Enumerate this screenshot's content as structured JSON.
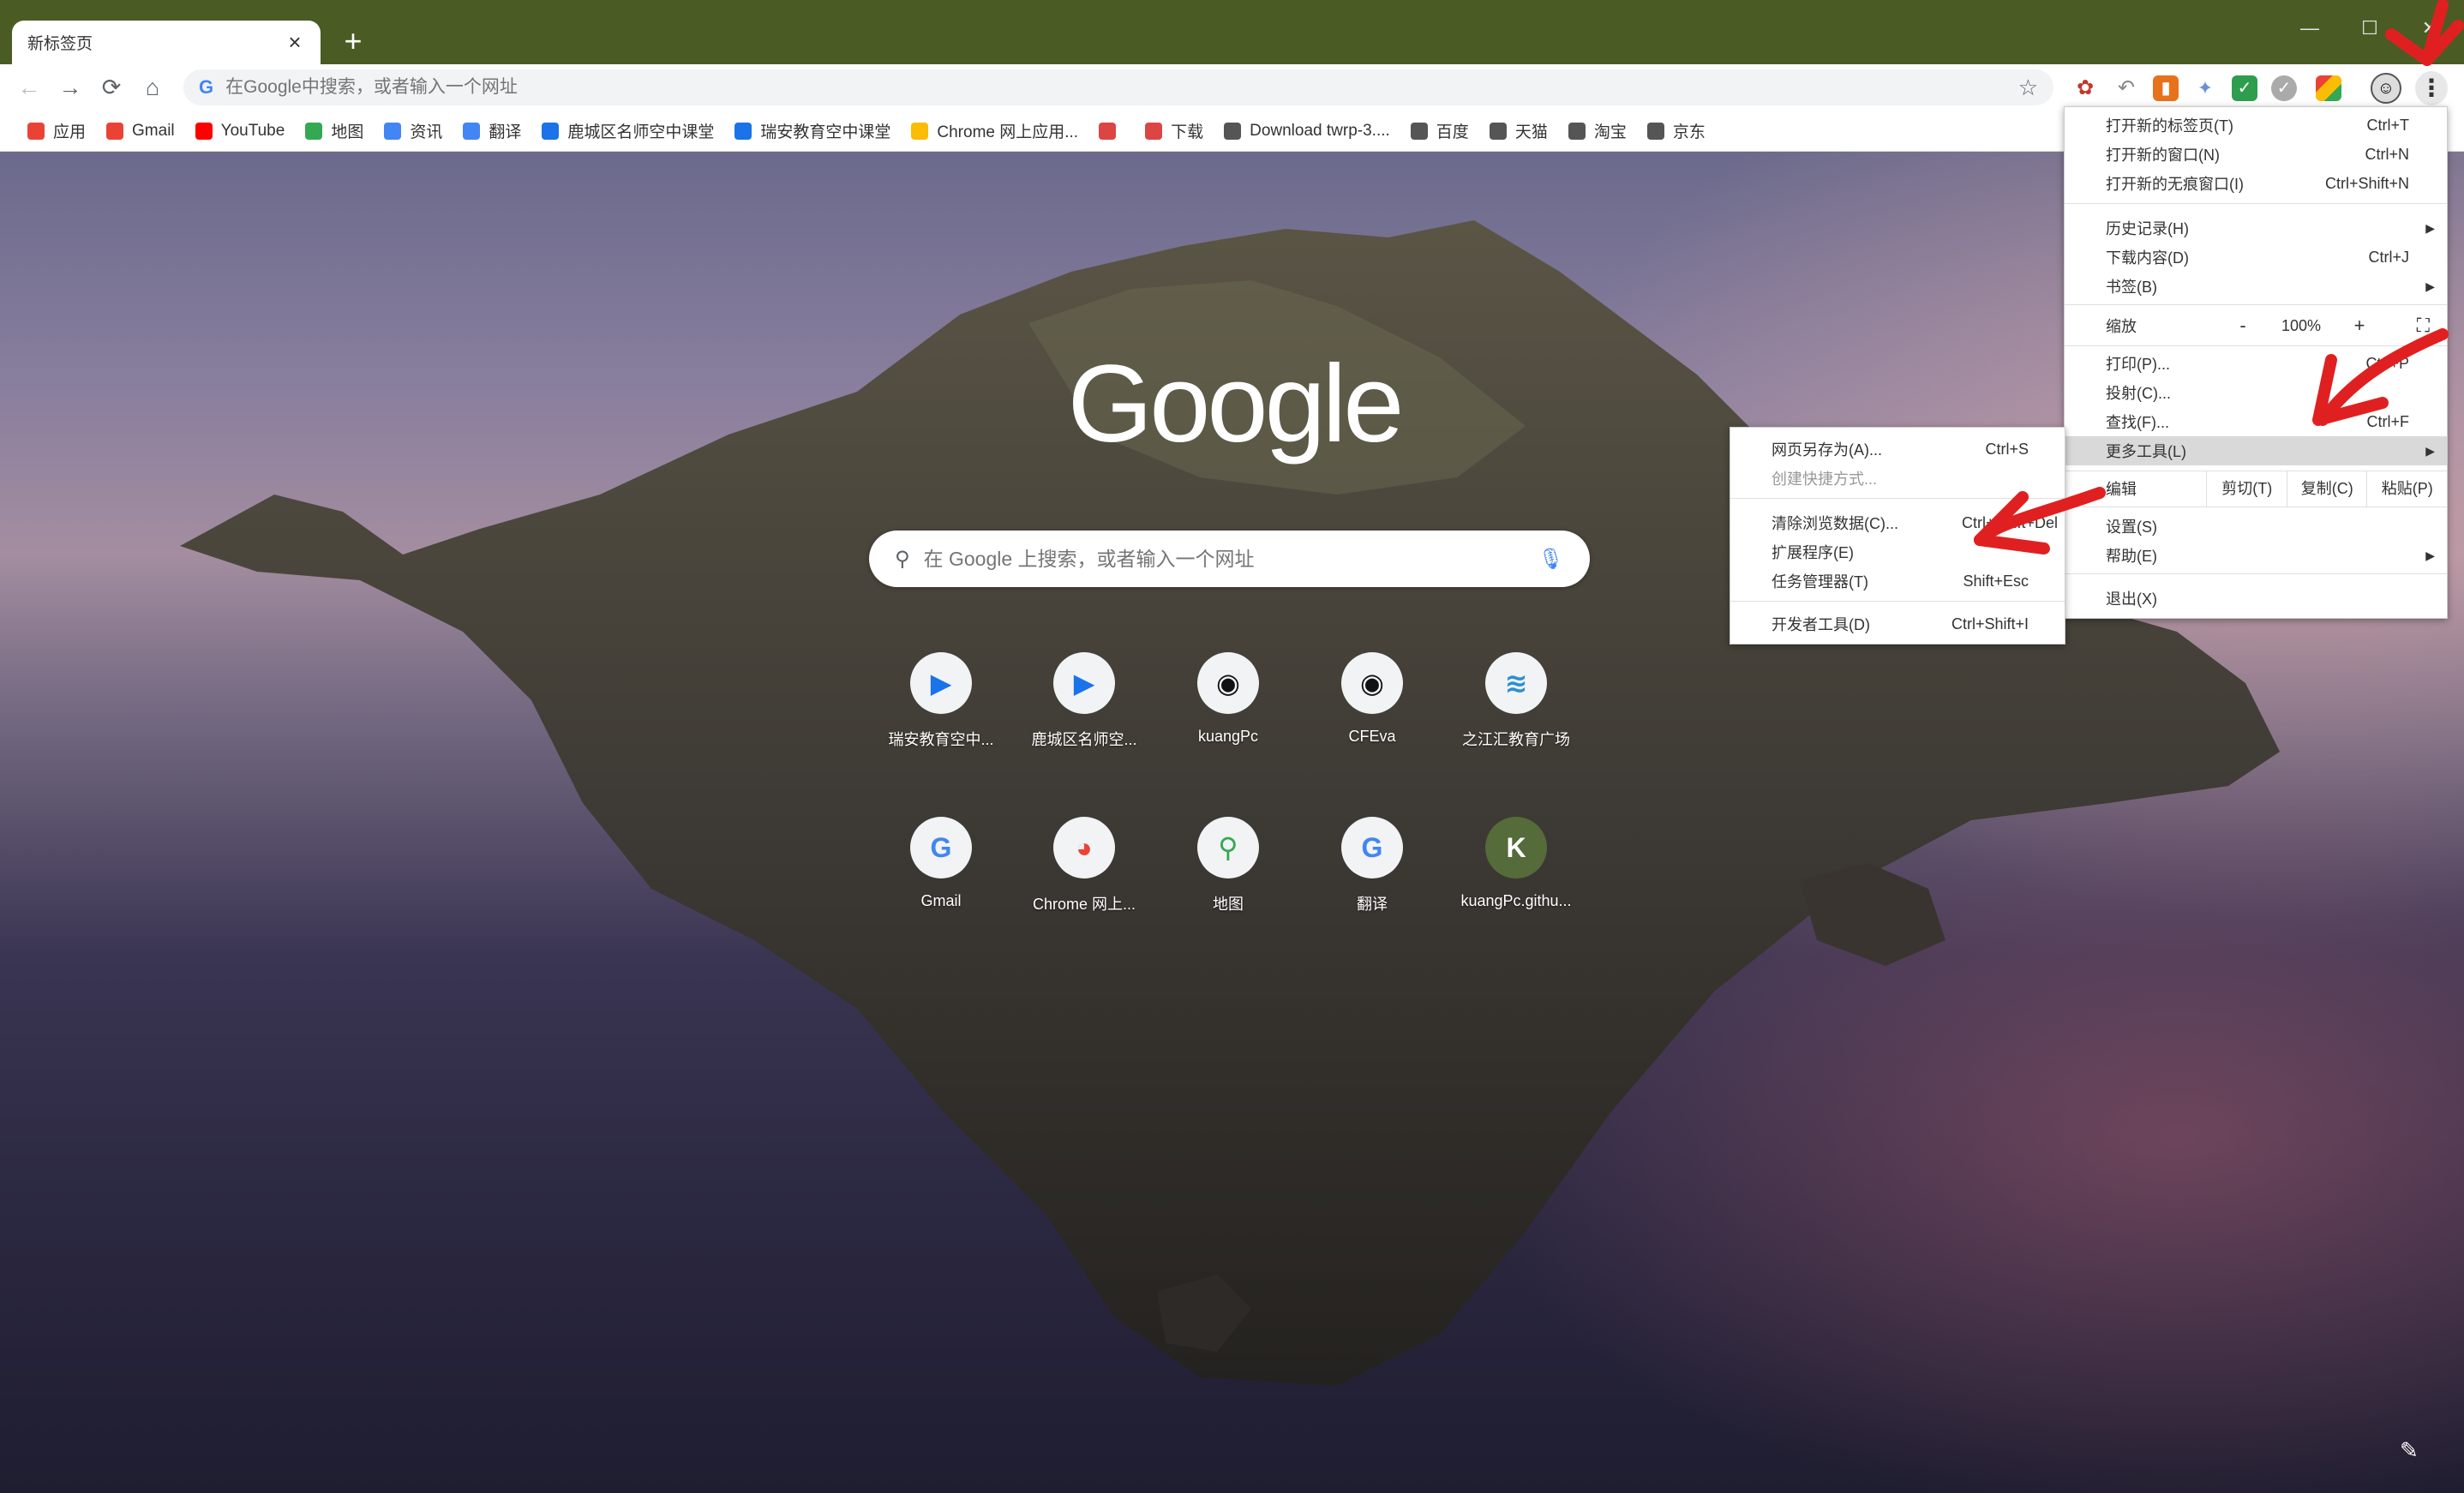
{
  "window": {
    "tab_title": "新标签页",
    "tab_close_icon": "×",
    "new_tab_icon": "+",
    "minimize_icon": "—",
    "maximize_icon": "☐",
    "close_icon": "✕"
  },
  "toolbar": {
    "back_icon": "←",
    "forward_icon": "→",
    "reload_icon": "⟳",
    "home_icon": "⌂",
    "omnibox_placeholder": "在Google中搜索，或者输入一个网址",
    "star_icon": "☆",
    "kebab_icon": "⋮"
  },
  "bookmarks": [
    {
      "label": "应用",
      "icon": "apps-grid",
      "color": "#ea4335"
    },
    {
      "label": "Gmail",
      "icon": "gmail",
      "color": "#ea4335"
    },
    {
      "label": "YouTube",
      "icon": "youtube",
      "color": "#ff0000"
    },
    {
      "label": "地图",
      "icon": "maps",
      "color": "#34a853"
    },
    {
      "label": "资讯",
      "icon": "news",
      "color": "#4285f4"
    },
    {
      "label": "翻译",
      "icon": "translate",
      "color": "#4285f4"
    },
    {
      "label": "鹿城区名师空中课堂",
      "icon": "play",
      "color": "#1a73e8"
    },
    {
      "label": "瑞安教育空中课堂",
      "icon": "play",
      "color": "#1a73e8"
    },
    {
      "label": "Chrome 网上应用...",
      "icon": "webstore",
      "color": "#fbbc04"
    },
    {
      "label": "",
      "icon": "folder-red",
      "color": "#d44"
    },
    {
      "label": "下载",
      "icon": "folder-red",
      "color": "#d44"
    },
    {
      "label": "Download twrp-3....",
      "icon": "globe",
      "color": "#555"
    },
    {
      "label": "百度",
      "icon": "globe",
      "color": "#555"
    },
    {
      "label": "天猫",
      "icon": "globe",
      "color": "#555"
    },
    {
      "label": "淘宝",
      "icon": "globe",
      "color": "#555"
    },
    {
      "label": "京东",
      "icon": "globe",
      "color": "#555"
    }
  ],
  "ntp": {
    "logo_text": "Google",
    "search_placeholder": "在 Google 上搜索，或者输入一个网址",
    "shortcuts_row1": [
      {
        "label": "瑞安教育空中...",
        "glyph": "▶",
        "color": "#1a73e8"
      },
      {
        "label": "鹿城区名师空...",
        "glyph": "▶",
        "color": "#1a73e8"
      },
      {
        "label": "kuangPc",
        "glyph": "◉",
        "color": "#111"
      },
      {
        "label": "CFEva",
        "glyph": "◉",
        "color": "#111"
      },
      {
        "label": "之江汇教育广场",
        "glyph": "≋",
        "color": "#2b8fd6"
      }
    ],
    "shortcuts_row2": [
      {
        "label": "Gmail",
        "glyph": "G",
        "color": "#4285f4"
      },
      {
        "label": "Chrome 网上...",
        "glyph": "◕",
        "color": "#ea4335"
      },
      {
        "label": "地图",
        "glyph": "⚲",
        "color": "#34a853"
      },
      {
        "label": "翻译",
        "glyph": "G",
        "color": "#4285f4"
      },
      {
        "label": "kuangPc.githu...",
        "glyph": "K",
        "color": "#fff"
      }
    ]
  },
  "main_menu": {
    "items": [
      {
        "label": "打开新的标签页(T)",
        "shortcut": "Ctrl+T"
      },
      {
        "label": "打开新的窗口(N)",
        "shortcut": "Ctrl+N"
      },
      {
        "label": "打开新的无痕窗口(I)",
        "shortcut": "Ctrl+Shift+N"
      },
      {
        "label": "历史记录(H)",
        "shortcut": ""
      },
      {
        "label": "下载内容(D)",
        "shortcut": "Ctrl+J"
      },
      {
        "label": "书签(B)",
        "shortcut": ""
      },
      {
        "label": "打印(P)...",
        "shortcut": "Ctrl+P"
      },
      {
        "label": "投射(C)...",
        "shortcut": ""
      },
      {
        "label": "查找(F)...",
        "shortcut": "Ctrl+F"
      },
      {
        "label": "更多工具(L)",
        "shortcut": ""
      },
      {
        "label": "设置(S)",
        "shortcut": ""
      },
      {
        "label": "帮助(E)",
        "shortcut": ""
      },
      {
        "label": "退出(X)",
        "shortcut": ""
      }
    ],
    "zoom": {
      "label": "缩放",
      "minus": "-",
      "value": "100%",
      "plus": "+",
      "fullscreen": "⛶"
    },
    "edit": {
      "label": "编辑",
      "cut": "剪切(T)",
      "copy": "复制(C)",
      "paste": "粘贴(P)"
    }
  },
  "submenu": {
    "items": [
      {
        "label": "网页另存为(A)...",
        "shortcut": "Ctrl+S"
      },
      {
        "label": "创建快捷方式...",
        "shortcut": ""
      },
      {
        "label": "清除浏览数据(C)...",
        "shortcut": "Ctrl+Shift+Del"
      },
      {
        "label": "扩展程序(E)",
        "shortcut": ""
      },
      {
        "label": "任务管理器(T)",
        "shortcut": "Shift+Esc"
      },
      {
        "label": "开发者工具(D)",
        "shortcut": "Ctrl+Shift+I"
      }
    ]
  },
  "colors": {
    "titlebar": "#4a5c23",
    "annotation": "#e02020",
    "menu_highlight": "#d9d9d9"
  },
  "customize_icon": "✎"
}
